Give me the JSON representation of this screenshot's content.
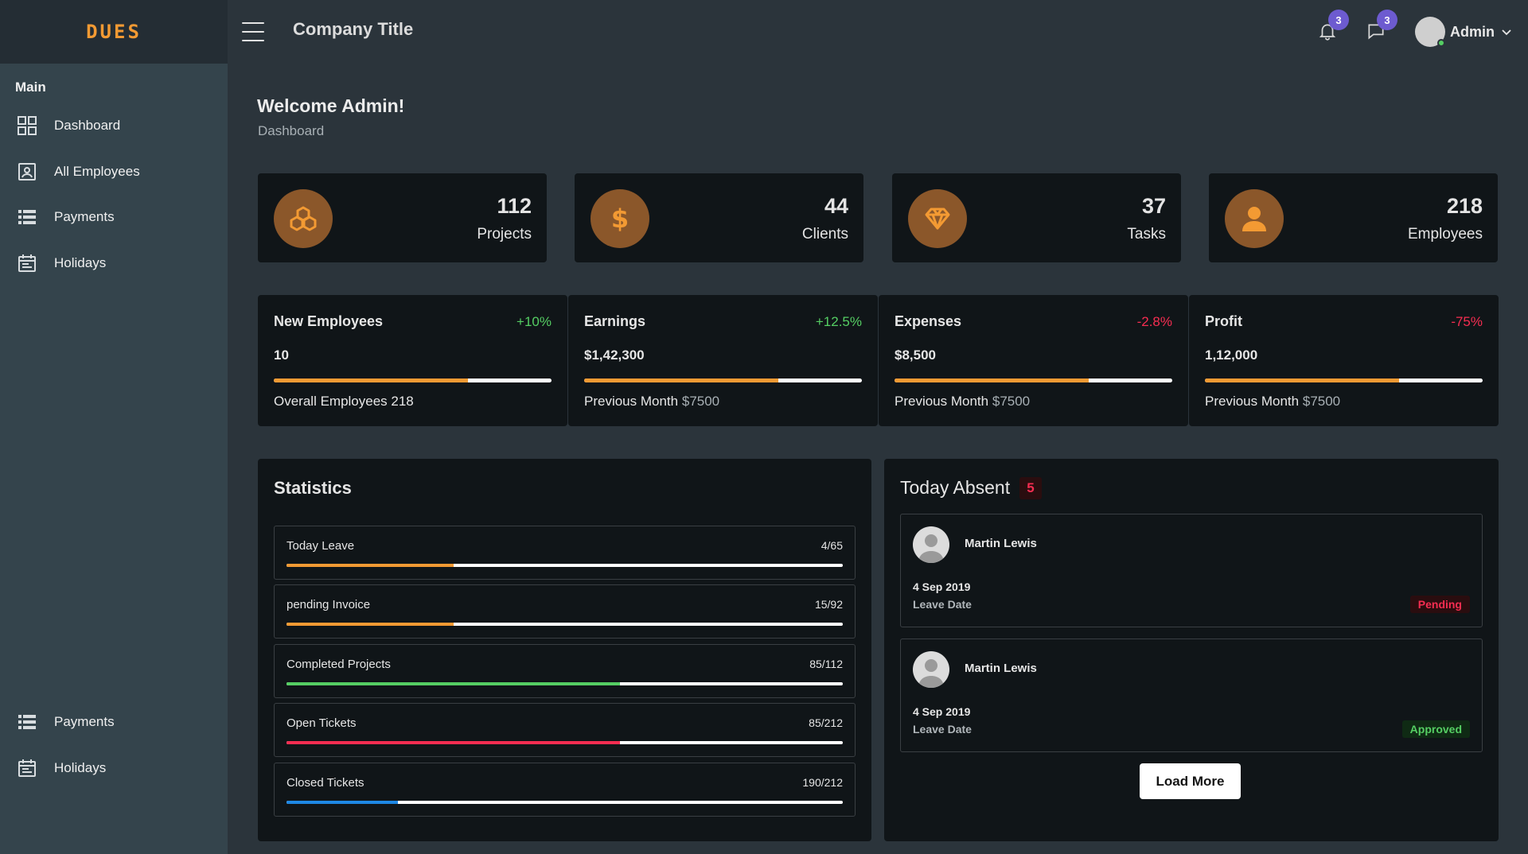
{
  "header": {
    "logo": "DUES",
    "company_title": "Company Title",
    "notifications_count": "3",
    "messages_count": "3",
    "user_name": "Admin"
  },
  "sidebar": {
    "heading": "Main",
    "items": [
      {
        "label": "Dashboard",
        "icon": "dashboard-grid-icon"
      },
      {
        "label": "All Employees",
        "icon": "contact-card-icon"
      },
      {
        "label": "Payments",
        "icon": "list-icon"
      },
      {
        "label": "Holidays",
        "icon": "calendar-icon"
      }
    ],
    "bottom_items": [
      {
        "label": "Payments",
        "icon": "list-icon"
      },
      {
        "label": "Holidays",
        "icon": "calendar-icon"
      }
    ]
  },
  "page": {
    "welcome": "Welcome Admin!",
    "breadcrumb": "Dashboard"
  },
  "stats": [
    {
      "value": "112",
      "label": "Projects",
      "icon": "cubes-icon"
    },
    {
      "value": "44",
      "label": "Clients",
      "icon": "dollar-icon"
    },
    {
      "value": "37",
      "label": "Tasks",
      "icon": "diamond-icon"
    },
    {
      "value": "218",
      "label": "Employees",
      "icon": "user-icon"
    }
  ],
  "kpis": [
    {
      "title": "New Employees",
      "change": "+10%",
      "value": "10",
      "progress": 0.7,
      "foot_label": "Overall Employees 218",
      "foot_value": ""
    },
    {
      "title": "Earnings",
      "change": "+12.5%",
      "value": "$1,42,300",
      "progress": 0.7,
      "foot_label": "Previous Month",
      "foot_value": "$7500"
    },
    {
      "title": "Expenses",
      "change": "-2.8%",
      "value": "$8,500",
      "progress": 0.7,
      "foot_label": "Previous Month",
      "foot_value": "$7500"
    },
    {
      "title": "Profit",
      "change": "-75%",
      "value": "1,12,000",
      "progress": 0.7,
      "foot_label": "Previous Month",
      "foot_value": "$7500"
    }
  ],
  "colors": {
    "accent": "#f39a33",
    "positive": "#55ce63",
    "negative": "#f62d51",
    "info": "#1e88e5",
    "badge": "#6d5bd0"
  },
  "statistics": {
    "title": "Statistics",
    "rows": [
      {
        "name": "Today Leave",
        "value": "4/65",
        "progress": 0.3,
        "color": "#f39a33"
      },
      {
        "name": "pending Invoice",
        "value": "15/92",
        "progress": 0.3,
        "color": "#f39a33"
      },
      {
        "name": "Completed Projects",
        "value": "85/112",
        "progress": 0.6,
        "color": "#55ce63"
      },
      {
        "name": "Open Tickets",
        "value": "85/212",
        "progress": 0.6,
        "color": "#f62d51"
      },
      {
        "name": "Closed Tickets",
        "value": "190/212",
        "progress": 0.2,
        "color": "#1e88e5"
      }
    ]
  },
  "absent": {
    "title": "Today Absent",
    "count": "5",
    "items": [
      {
        "name": "Martin Lewis",
        "date": "4 Sep 2019",
        "date_label": "Leave Date",
        "status": "Pending",
        "status_color": "#f62d51",
        "status_bg": "#2a0d0f"
      },
      {
        "name": "Martin Lewis",
        "date": "4 Sep 2019",
        "date_label": "Leave Date",
        "status": "Approved",
        "status_color": "#55ce63",
        "status_bg": "#0f2a14"
      }
    ],
    "load_more": "Load More"
  }
}
